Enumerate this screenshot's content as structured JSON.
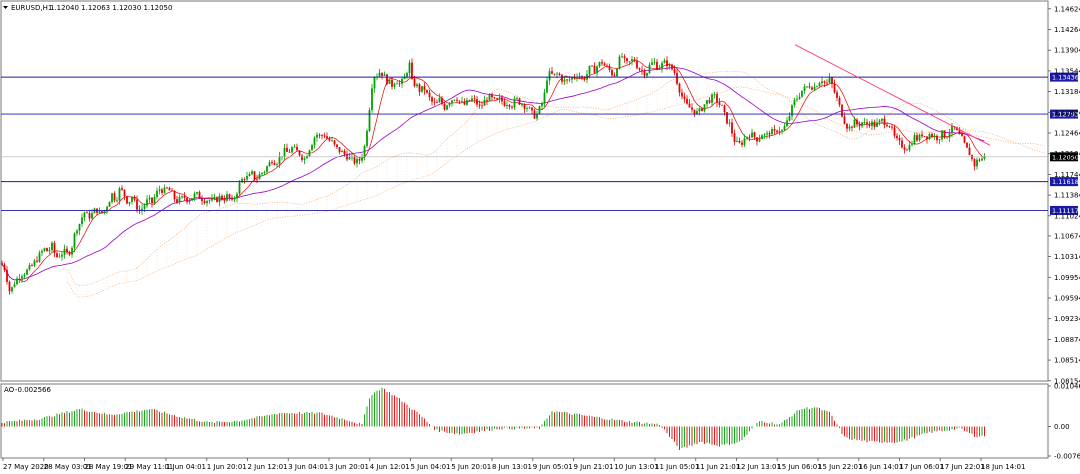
{
  "header": {
    "symbol": "EURUSD,H1",
    "ohlc": "1.12040 1.12063 1.12030 1.12050"
  },
  "chart_data": {
    "type": "candlestick",
    "symbol": "EURUSD",
    "timeframe": "H1",
    "ohlc_last": {
      "open": 1.1204,
      "high": 1.12063,
      "low": 1.1203,
      "close": 1.1205
    },
    "current_price": 1.1205,
    "y_ticks": [
      "1.14624",
      "1.14264",
      "1.13904",
      "1.13544",
      "1.13184",
      "1.12824",
      "1.12464",
      "1.12104",
      "1.11744",
      "1.11384",
      "1.11024",
      "1.10674",
      "1.10314",
      "1.09954",
      "1.09594",
      "1.09234",
      "1.08874",
      "1.08514",
      "1.08154"
    ],
    "ylim": [
      1.0815,
      1.1476
    ],
    "x_ticks": [
      "27 May 2020",
      "28 May 03:01",
      "28 May 19:01",
      "29 May 11:01",
      "1 Jun 04:01",
      "1 Jun 20:01",
      "2 Jun 12:01",
      "3 Jun 04:01",
      "3 Jun 20:01",
      "4 Jun 12:01",
      "5 Jun 04:01",
      "5 Jun 20:01",
      "8 Jun 13:01",
      "9 Jun 05:01",
      "9 Jun 21:01",
      "10 Jun 13:01",
      "11 Jun 05:01",
      "11 Jun 21:01",
      "12 Jun 13:01",
      "15 Jun 06:01",
      "15 Jun 22:01",
      "16 Jun 14:01",
      "17 Jun 06:01",
      "17 Jun 22:01",
      "18 Jun 14:01"
    ],
    "levels": [
      {
        "label": "1.13436",
        "value": 1.13436,
        "color": "#1a1aa6"
      },
      {
        "label": "1.12793",
        "value": 1.12793,
        "color": "#1a1aa6"
      },
      {
        "label": "1.11618",
        "value": 1.11618,
        "color": "#1a1aa6"
      },
      {
        "label": "1.11117",
        "value": 1.11117,
        "color": "#1a1aa6"
      }
    ],
    "path_points": [
      [
        0,
        1.102
      ],
      [
        4,
        1.1015
      ],
      [
        8,
        1.0985
      ],
      [
        10,
        1.0968
      ],
      [
        14,
        1.0985
      ],
      [
        20,
        1.1
      ],
      [
        26,
        1.1005
      ],
      [
        32,
        1.1015
      ],
      [
        36,
        1.1025
      ],
      [
        40,
        1.1035
      ],
      [
        44,
        1.1045
      ],
      [
        48,
        1.104
      ],
      [
        52,
        1.105
      ],
      [
        56,
        1.103
      ],
      [
        60,
        1.1035
      ],
      [
        64,
        1.104
      ],
      [
        68,
        1.1035
      ],
      [
        72,
        1.105
      ],
      [
        76,
        1.108
      ],
      [
        80,
        1.109
      ],
      [
        84,
        1.111
      ],
      [
        88,
        1.11
      ],
      [
        92,
        1.1105
      ],
      [
        96,
        1.1115
      ],
      [
        100,
        1.1105
      ],
      [
        104,
        1.111
      ],
      [
        108,
        1.1125
      ],
      [
        112,
        1.114
      ],
      [
        116,
        1.113
      ],
      [
        120,
        1.115
      ],
      [
        124,
        1.114
      ],
      [
        128,
        1.1125
      ],
      [
        132,
        1.1135
      ],
      [
        136,
        1.112
      ],
      [
        140,
        1.111
      ],
      [
        144,
        1.112
      ],
      [
        148,
        1.113
      ],
      [
        152,
        1.1125
      ],
      [
        156,
        1.114
      ],
      [
        160,
        1.115
      ],
      [
        164,
        1.1145
      ],
      [
        168,
        1.115
      ],
      [
        172,
        1.114
      ],
      [
        176,
        1.1128
      ],
      [
        180,
        1.113
      ],
      [
        184,
        1.1135
      ],
      [
        188,
        1.113
      ],
      [
        192,
        1.1135
      ],
      [
        196,
        1.114
      ],
      [
        200,
        1.1135
      ],
      [
        204,
        1.113
      ],
      [
        208,
        1.113
      ],
      [
        212,
        1.1128
      ],
      [
        216,
        1.113
      ],
      [
        220,
        1.1135
      ],
      [
        224,
        1.1132
      ],
      [
        228,
        1.1138
      ],
      [
        232,
        1.1125
      ],
      [
        236,
        1.114
      ],
      [
        240,
        1.116
      ],
      [
        244,
        1.117
      ],
      [
        248,
        1.1168
      ],
      [
        252,
        1.1175
      ],
      [
        256,
        1.1165
      ],
      [
        260,
        1.1175
      ],
      [
        264,
        1.118
      ],
      [
        268,
        1.119
      ],
      [
        272,
        1.12
      ],
      [
        276,
        1.1195
      ],
      [
        280,
        1.1205
      ],
      [
        284,
        1.1215
      ],
      [
        288,
        1.1212
      ],
      [
        292,
        1.122
      ],
      [
        296,
        1.1215
      ],
      [
        300,
        1.121
      ],
      [
        304,
        1.12
      ],
      [
        308,
        1.1215
      ],
      [
        312,
        1.123
      ],
      [
        316,
        1.1245
      ],
      [
        320,
        1.124
      ],
      [
        324,
        1.1245
      ],
      [
        328,
        1.1235
      ],
      [
        332,
        1.123
      ],
      [
        336,
        1.122
      ],
      [
        340,
        1.1215
      ],
      [
        344,
        1.121
      ],
      [
        348,
        1.1205
      ],
      [
        352,
        1.12
      ],
      [
        356,
        1.1195
      ],
      [
        360,
        1.12
      ],
      [
        364,
        1.1215
      ],
      [
        366,
        1.1245
      ],
      [
        368,
        1.1265
      ],
      [
        370,
        1.13
      ],
      [
        372,
        1.133
      ],
      [
        374,
        1.1345
      ],
      [
        376,
        1.135
      ],
      [
        378,
        1.1345
      ],
      [
        380,
        1.1355
      ],
      [
        384,
        1.1345
      ],
      [
        388,
        1.1335
      ],
      [
        392,
        1.133
      ],
      [
        396,
        1.134
      ],
      [
        400,
        1.133
      ],
      [
        404,
        1.134
      ],
      [
        408,
        1.136
      ],
      [
        410,
        1.1368
      ],
      [
        412,
        1.1335
      ],
      [
        416,
        1.133
      ],
      [
        420,
        1.132
      ],
      [
        424,
        1.1325
      ],
      [
        428,
        1.131
      ],
      [
        432,
        1.13
      ],
      [
        436,
        1.1295
      ],
      [
        440,
        1.1305
      ],
      [
        444,
        1.129
      ],
      [
        448,
        1.13
      ],
      [
        452,
        1.1305
      ],
      [
        456,
        1.131
      ],
      [
        460,
        1.13
      ],
      [
        464,
        1.1295
      ],
      [
        468,
        1.13
      ],
      [
        472,
        1.1305
      ],
      [
        476,
        1.13
      ],
      [
        480,
        1.129
      ],
      [
        484,
        1.13
      ],
      [
        488,
        1.131
      ],
      [
        492,
        1.1305
      ],
      [
        496,
        1.13
      ],
      [
        500,
        1.1305
      ],
      [
        504,
        1.1298
      ],
      [
        508,
        1.13
      ],
      [
        512,
        1.1295
      ],
      [
        516,
        1.1305
      ],
      [
        520,
        1.13
      ],
      [
        524,
        1.1295
      ],
      [
        528,
        1.129
      ],
      [
        532,
        1.128
      ],
      [
        536,
        1.1275
      ],
      [
        540,
        1.129
      ],
      [
        544,
        1.1305
      ],
      [
        546,
        1.134
      ],
      [
        550,
        1.135
      ],
      [
        554,
        1.1345
      ],
      [
        558,
        1.135
      ],
      [
        562,
        1.134
      ],
      [
        566,
        1.1335
      ],
      [
        570,
        1.134
      ],
      [
        574,
        1.1345
      ],
      [
        578,
        1.135
      ],
      [
        582,
        1.134
      ],
      [
        586,
        1.1345
      ],
      [
        590,
        1.136
      ],
      [
        594,
        1.1355
      ],
      [
        598,
        1.1365
      ],
      [
        602,
        1.137
      ],
      [
        606,
        1.136
      ],
      [
        610,
        1.1355
      ],
      [
        614,
        1.1345
      ],
      [
        618,
        1.137
      ],
      [
        622,
        1.138
      ],
      [
        626,
        1.1365
      ],
      [
        630,
        1.137
      ],
      [
        634,
        1.1375
      ],
      [
        638,
        1.136
      ],
      [
        642,
        1.1355
      ],
      [
        646,
        1.135
      ],
      [
        650,
        1.1365
      ],
      [
        654,
        1.137
      ],
      [
        658,
        1.136
      ],
      [
        662,
        1.1365
      ],
      [
        666,
        1.137
      ],
      [
        670,
        1.136
      ],
      [
        674,
        1.1355
      ],
      [
        678,
        1.133
      ],
      [
        682,
        1.131
      ],
      [
        686,
        1.1295
      ],
      [
        690,
        1.129
      ],
      [
        694,
        1.1285
      ],
      [
        698,
        1.128
      ],
      [
        702,
        1.129
      ],
      [
        706,
        1.13
      ],
      [
        710,
        1.1305
      ],
      [
        714,
        1.131
      ],
      [
        718,
        1.13
      ],
      [
        722,
        1.129
      ],
      [
        726,
        1.127
      ],
      [
        730,
        1.126
      ],
      [
        734,
        1.1235
      ],
      [
        738,
        1.1225
      ],
      [
        742,
        1.123
      ],
      [
        746,
        1.124
      ],
      [
        750,
        1.1245
      ],
      [
        754,
        1.124
      ],
      [
        758,
        1.1235
      ],
      [
        762,
        1.1245
      ],
      [
        766,
        1.124
      ],
      [
        770,
        1.125
      ],
      [
        774,
        1.1245
      ],
      [
        778,
        1.1255
      ],
      [
        782,
        1.125
      ],
      [
        786,
        1.126
      ],
      [
        790,
        1.128
      ],
      [
        794,
        1.13
      ],
      [
        798,
        1.131
      ],
      [
        802,
        1.132
      ],
      [
        806,
        1.1325
      ],
      [
        810,
        1.133
      ],
      [
        814,
        1.1325
      ],
      [
        818,
        1.1335
      ],
      [
        822,
        1.134
      ],
      [
        826,
        1.133
      ],
      [
        830,
        1.134
      ],
      [
        834,
        1.132
      ],
      [
        838,
        1.13
      ],
      [
        842,
        1.128
      ],
      [
        846,
        1.126
      ],
      [
        850,
        1.1255
      ],
      [
        854,
        1.1265
      ],
      [
        858,
        1.126
      ],
      [
        862,
        1.1265
      ],
      [
        866,
        1.126
      ],
      [
        870,
        1.1265
      ],
      [
        874,
        1.126
      ],
      [
        878,
        1.1262
      ],
      [
        882,
        1.1268
      ],
      [
        886,
        1.1265
      ],
      [
        890,
        1.126
      ],
      [
        894,
        1.124
      ],
      [
        898,
        1.123
      ],
      [
        902,
        1.1225
      ],
      [
        906,
        1.122
      ],
      [
        910,
        1.1225
      ],
      [
        914,
        1.124
      ],
      [
        918,
        1.1235
      ],
      [
        922,
        1.1245
      ],
      [
        926,
        1.124
      ],
      [
        930,
        1.1245
      ],
      [
        934,
        1.124
      ],
      [
        938,
        1.1238
      ],
      [
        942,
        1.1245
      ],
      [
        946,
        1.124
      ],
      [
        950,
        1.125
      ],
      [
        954,
        1.1255
      ],
      [
        958,
        1.1245
      ],
      [
        962,
        1.1235
      ],
      [
        966,
        1.122
      ],
      [
        970,
        1.121
      ],
      [
        974,
        1.119
      ],
      [
        978,
        1.12
      ],
      [
        982,
        1.1202
      ],
      [
        986,
        1.1205
      ]
    ],
    "trendline": [
      [
        795,
        1.14
      ],
      [
        990,
        1.1225
      ]
    ],
    "oscillator": {
      "name": "AO",
      "value": "-0.002566",
      "y_ticks": [
        "0.010469",
        "0.00",
        "-0.007641"
      ],
      "range": [
        -0.007641,
        0.010469
      ],
      "segments": [
        [
          0,
          0.001
        ],
        [
          40,
          0.002
        ],
        [
          80,
          0.0045
        ],
        [
          110,
          0.003
        ],
        [
          150,
          0.0045
        ],
        [
          180,
          0.0025
        ],
        [
          210,
          0.001
        ],
        [
          240,
          0.0015
        ],
        [
          280,
          0.0035
        ],
        [
          320,
          0.0035
        ],
        [
          350,
          0.0015
        ],
        [
          362,
          0.0005
        ],
        [
          370,
          0.008
        ],
        [
          382,
          0.01
        ],
        [
          400,
          0.007
        ],
        [
          420,
          0.003
        ],
        [
          436,
          -0.001
        ],
        [
          460,
          -0.002
        ],
        [
          500,
          -0.0005
        ],
        [
          540,
          -0.0005
        ],
        [
          552,
          0.004
        ],
        [
          580,
          0.003
        ],
        [
          620,
          0.0015
        ],
        [
          660,
          0.0005
        ],
        [
          680,
          -0.006
        ],
        [
          700,
          -0.004
        ],
        [
          720,
          -0.005
        ],
        [
          740,
          -0.004
        ],
        [
          760,
          0.0015
        ],
        [
          780,
          0.0005
        ],
        [
          800,
          0.0045
        ],
        [
          815,
          0.005
        ],
        [
          830,
          0.0035
        ],
        [
          845,
          -0.003
        ],
        [
          870,
          -0.004
        ],
        [
          900,
          -0.004
        ],
        [
          930,
          -0.0015
        ],
        [
          960,
          -0.0005
        ],
        [
          975,
          -0.0025
        ],
        [
          986,
          -0.0025
        ]
      ]
    },
    "grid": false,
    "colors": {
      "bull": "#00a000",
      "bear": "#e60000",
      "ma_fast": "#e60000",
      "ma_slow": "#9900cc",
      "cloud": "#f5a56a",
      "level": "#1a1aa6",
      "trend": "#ff3d7f"
    }
  }
}
